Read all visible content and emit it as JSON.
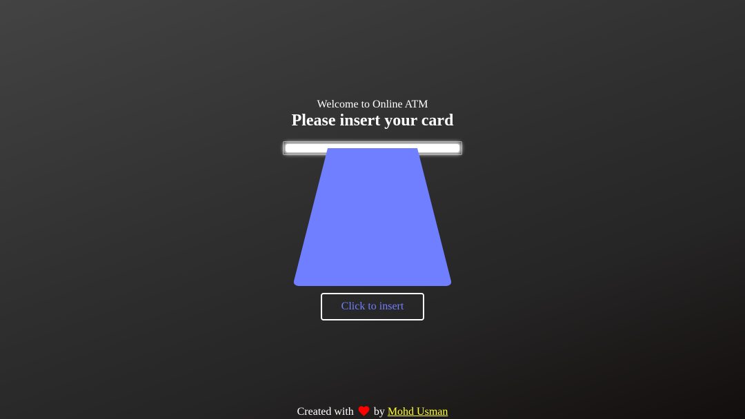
{
  "page": {
    "welcome_text": "Welcome to Online ATM",
    "title": "Please insert your card"
  },
  "card": {
    "color": "#6f7fff"
  },
  "insert_button": {
    "label": "Click to insert",
    "text_color": "#6f7fff"
  },
  "footer": {
    "prefix": "Created with",
    "heart_icon": "heart-icon",
    "heart_color": "#ff0000",
    "by": "by",
    "author": "Mohd Usman",
    "author_link_color": "#ffff33"
  },
  "colors": {
    "background_top": "#434343",
    "background_bottom": "#120e0d"
  }
}
